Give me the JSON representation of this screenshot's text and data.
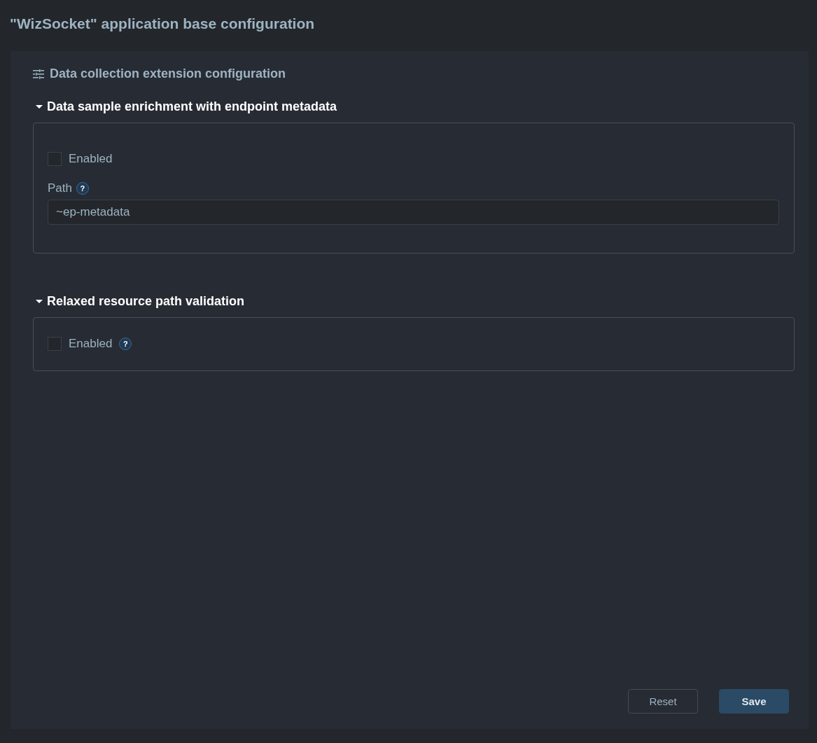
{
  "page_title": "\"WizSocket\" application base configuration",
  "panel": {
    "heading": "Data collection extension configuration",
    "sections": [
      {
        "title": "Data sample enrichment with endpoint metadata",
        "expanded": true,
        "fields": [
          {
            "kind": "checkbox",
            "label": "Enabled",
            "checked": false
          },
          {
            "kind": "text",
            "label": "Path",
            "help": "?",
            "value": "~ep-metadata"
          }
        ]
      },
      {
        "title": "Relaxed resource path validation",
        "expanded": true,
        "fields": [
          {
            "kind": "checkbox",
            "label": "Enabled",
            "checked": false,
            "help": "?"
          }
        ]
      }
    ]
  },
  "buttons": [
    {
      "label": "Reset",
      "kind": "secondary"
    },
    {
      "label": "Save",
      "kind": "primary"
    }
  ]
}
